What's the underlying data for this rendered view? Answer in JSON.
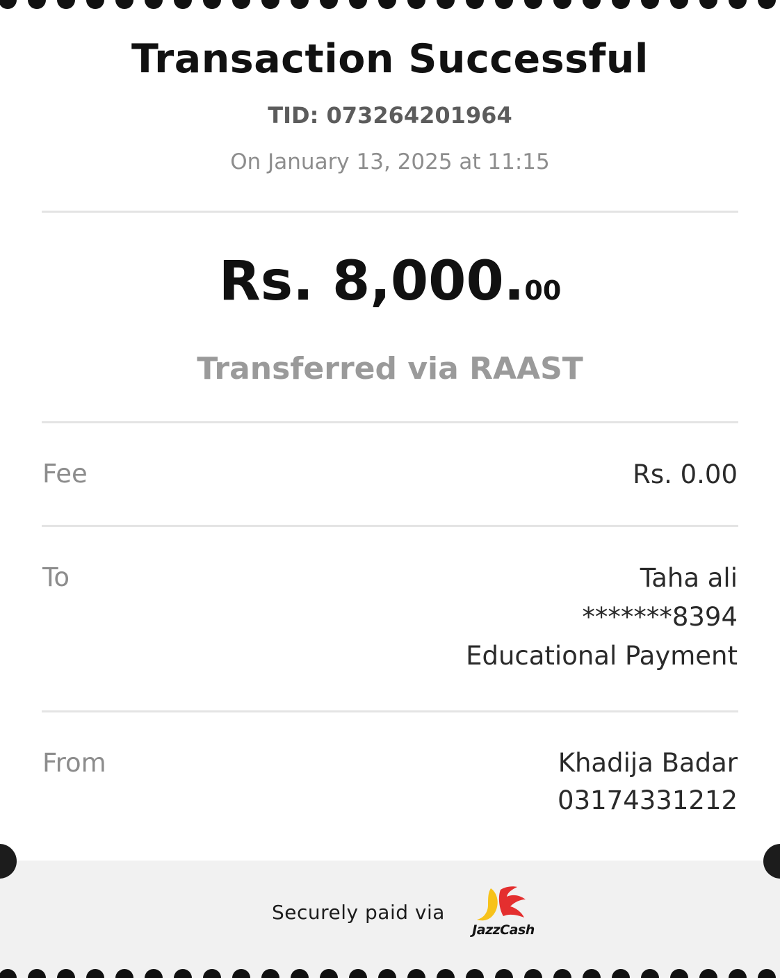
{
  "receipt": {
    "title": "Transaction Successful",
    "tid": "TID: 073264201964",
    "datetime": "On January 13, 2025 at 11:15",
    "amount_main": "Rs. 8,000.",
    "amount_cents": "00",
    "method": "Transferred via RAAST"
  },
  "details": {
    "fee": {
      "label": "Fee",
      "value": "Rs. 0.00"
    },
    "to": {
      "label": "To",
      "name": "Taha ali",
      "account": "*******8394",
      "purpose": "Educational Payment"
    },
    "from": {
      "label": "From",
      "name": "Khadija Badar",
      "phone": "03174331212"
    }
  },
  "footer": {
    "secure_text": "Securely paid via",
    "brand_name": "JazzCash",
    "brand_icon": "jazzcash-logo"
  },
  "colors": {
    "brand_yellow": "#f7c21a",
    "brand_red": "#e42f2f",
    "footer_bg": "#f1f1f1"
  }
}
